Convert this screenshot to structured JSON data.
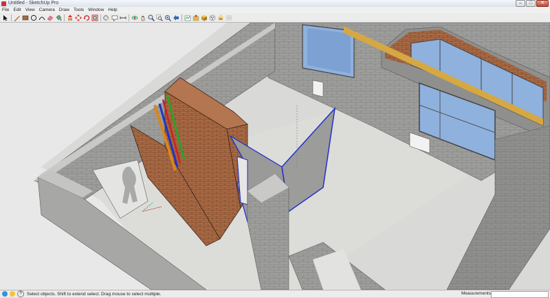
{
  "window": {
    "title": "Untitled - SketchUp Pro",
    "minimize": "–",
    "maximize": "□",
    "close": "✕"
  },
  "menu": [
    "File",
    "Edit",
    "View",
    "Camera",
    "Draw",
    "Tools",
    "Window",
    "Help"
  ],
  "toolbar": {
    "tools": [
      "select-arrow",
      "line-pencil",
      "rectangle",
      "circle",
      "arc",
      "eraser",
      "paint-bucket",
      "push-pull",
      "move",
      "rotate",
      "offset",
      "tape-measure",
      "text",
      "dimension",
      "orbit",
      "pan",
      "zoom",
      "zoom-window",
      "zoom-extents",
      "previous-view",
      "get-models",
      "share-model",
      "components",
      "styles",
      "materials",
      "section"
    ]
  },
  "status": {
    "icons": [
      "globe-icon",
      "credit-icon",
      "help-icon"
    ],
    "message": "Select objects. Shift to extend select. Drag mouse to select multiple.",
    "measurements_label": "Measurements",
    "measurements_value": ""
  },
  "colors": {
    "brick": "#a86a45",
    "concrete": "#9c9c9a",
    "floor": "#d8d8d6",
    "glass": "#8fb1de",
    "selection": "#1f2fcf"
  }
}
